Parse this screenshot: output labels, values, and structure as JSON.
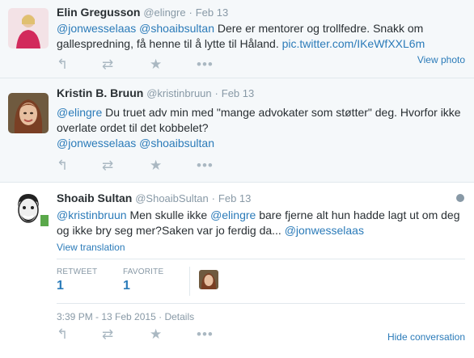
{
  "tweets": [
    {
      "name": "Elin Gregusson",
      "handle": "@elingre",
      "dot": "·",
      "date": "Feb 13",
      "text_parts": [
        {
          "t": "@jonwesselaas",
          "link": true
        },
        {
          "t": " ",
          "link": false
        },
        {
          "t": "@shoaibsultan",
          "link": true
        },
        {
          "t": " Dere er mentorer og trollfedre. Snakk om gallespredning, få henne til å lytte til Håland. ",
          "link": false
        },
        {
          "t": "pic.twitter.com/IKeWfXXL6m",
          "link": true
        }
      ],
      "view_photo": "View photo"
    },
    {
      "name": "Kristin B. Bruun",
      "handle": "@kristinbruun",
      "dot": "·",
      "date": "Feb 13",
      "text_parts": [
        {
          "t": "@elingre",
          "link": true
        },
        {
          "t": " Du truet adv min med \"mange advokater som støtter\" deg. Hvorfor ikke overlate ordet til det kobbelet?",
          "link": false
        }
      ],
      "mentions_line": "@jonwesselaas @shoaibsultan"
    },
    {
      "name": "Shoaib Sultan",
      "handle": "@ShoaibSultan",
      "dot": "·",
      "date": "Feb 13",
      "text_parts": [
        {
          "t": "@kristinbruun",
          "link": true
        },
        {
          "t": " Men skulle ikke ",
          "link": false
        },
        {
          "t": "@elingre",
          "link": true
        },
        {
          "t": " bare fjerne alt hun hadde lagt ut om deg og ikke bry seg mer?Saken var jo ferdig da... ",
          "link": false
        },
        {
          "t": "@jonwesselaas",
          "link": true
        }
      ],
      "view_translation": "View translation",
      "stats": {
        "retweet_label": "RETWEET",
        "retweet_count": "1",
        "favorite_label": "FAVORITE",
        "favorite_count": "1"
      },
      "timestamp": "3:39 PM - 13 Feb 2015",
      "details": "Details"
    }
  ],
  "hide_conversation": "Hide conversation",
  "icons": {
    "reply": "reply-icon",
    "retweet": "retweet-icon",
    "favorite": "star-icon",
    "more": "more-icon",
    "globe": "globe-icon"
  },
  "colors": {
    "link": "#2b7bb9",
    "muted": "#8899a6",
    "action_icon": "#aab8c2",
    "row_bg": "#f5f8fa"
  }
}
